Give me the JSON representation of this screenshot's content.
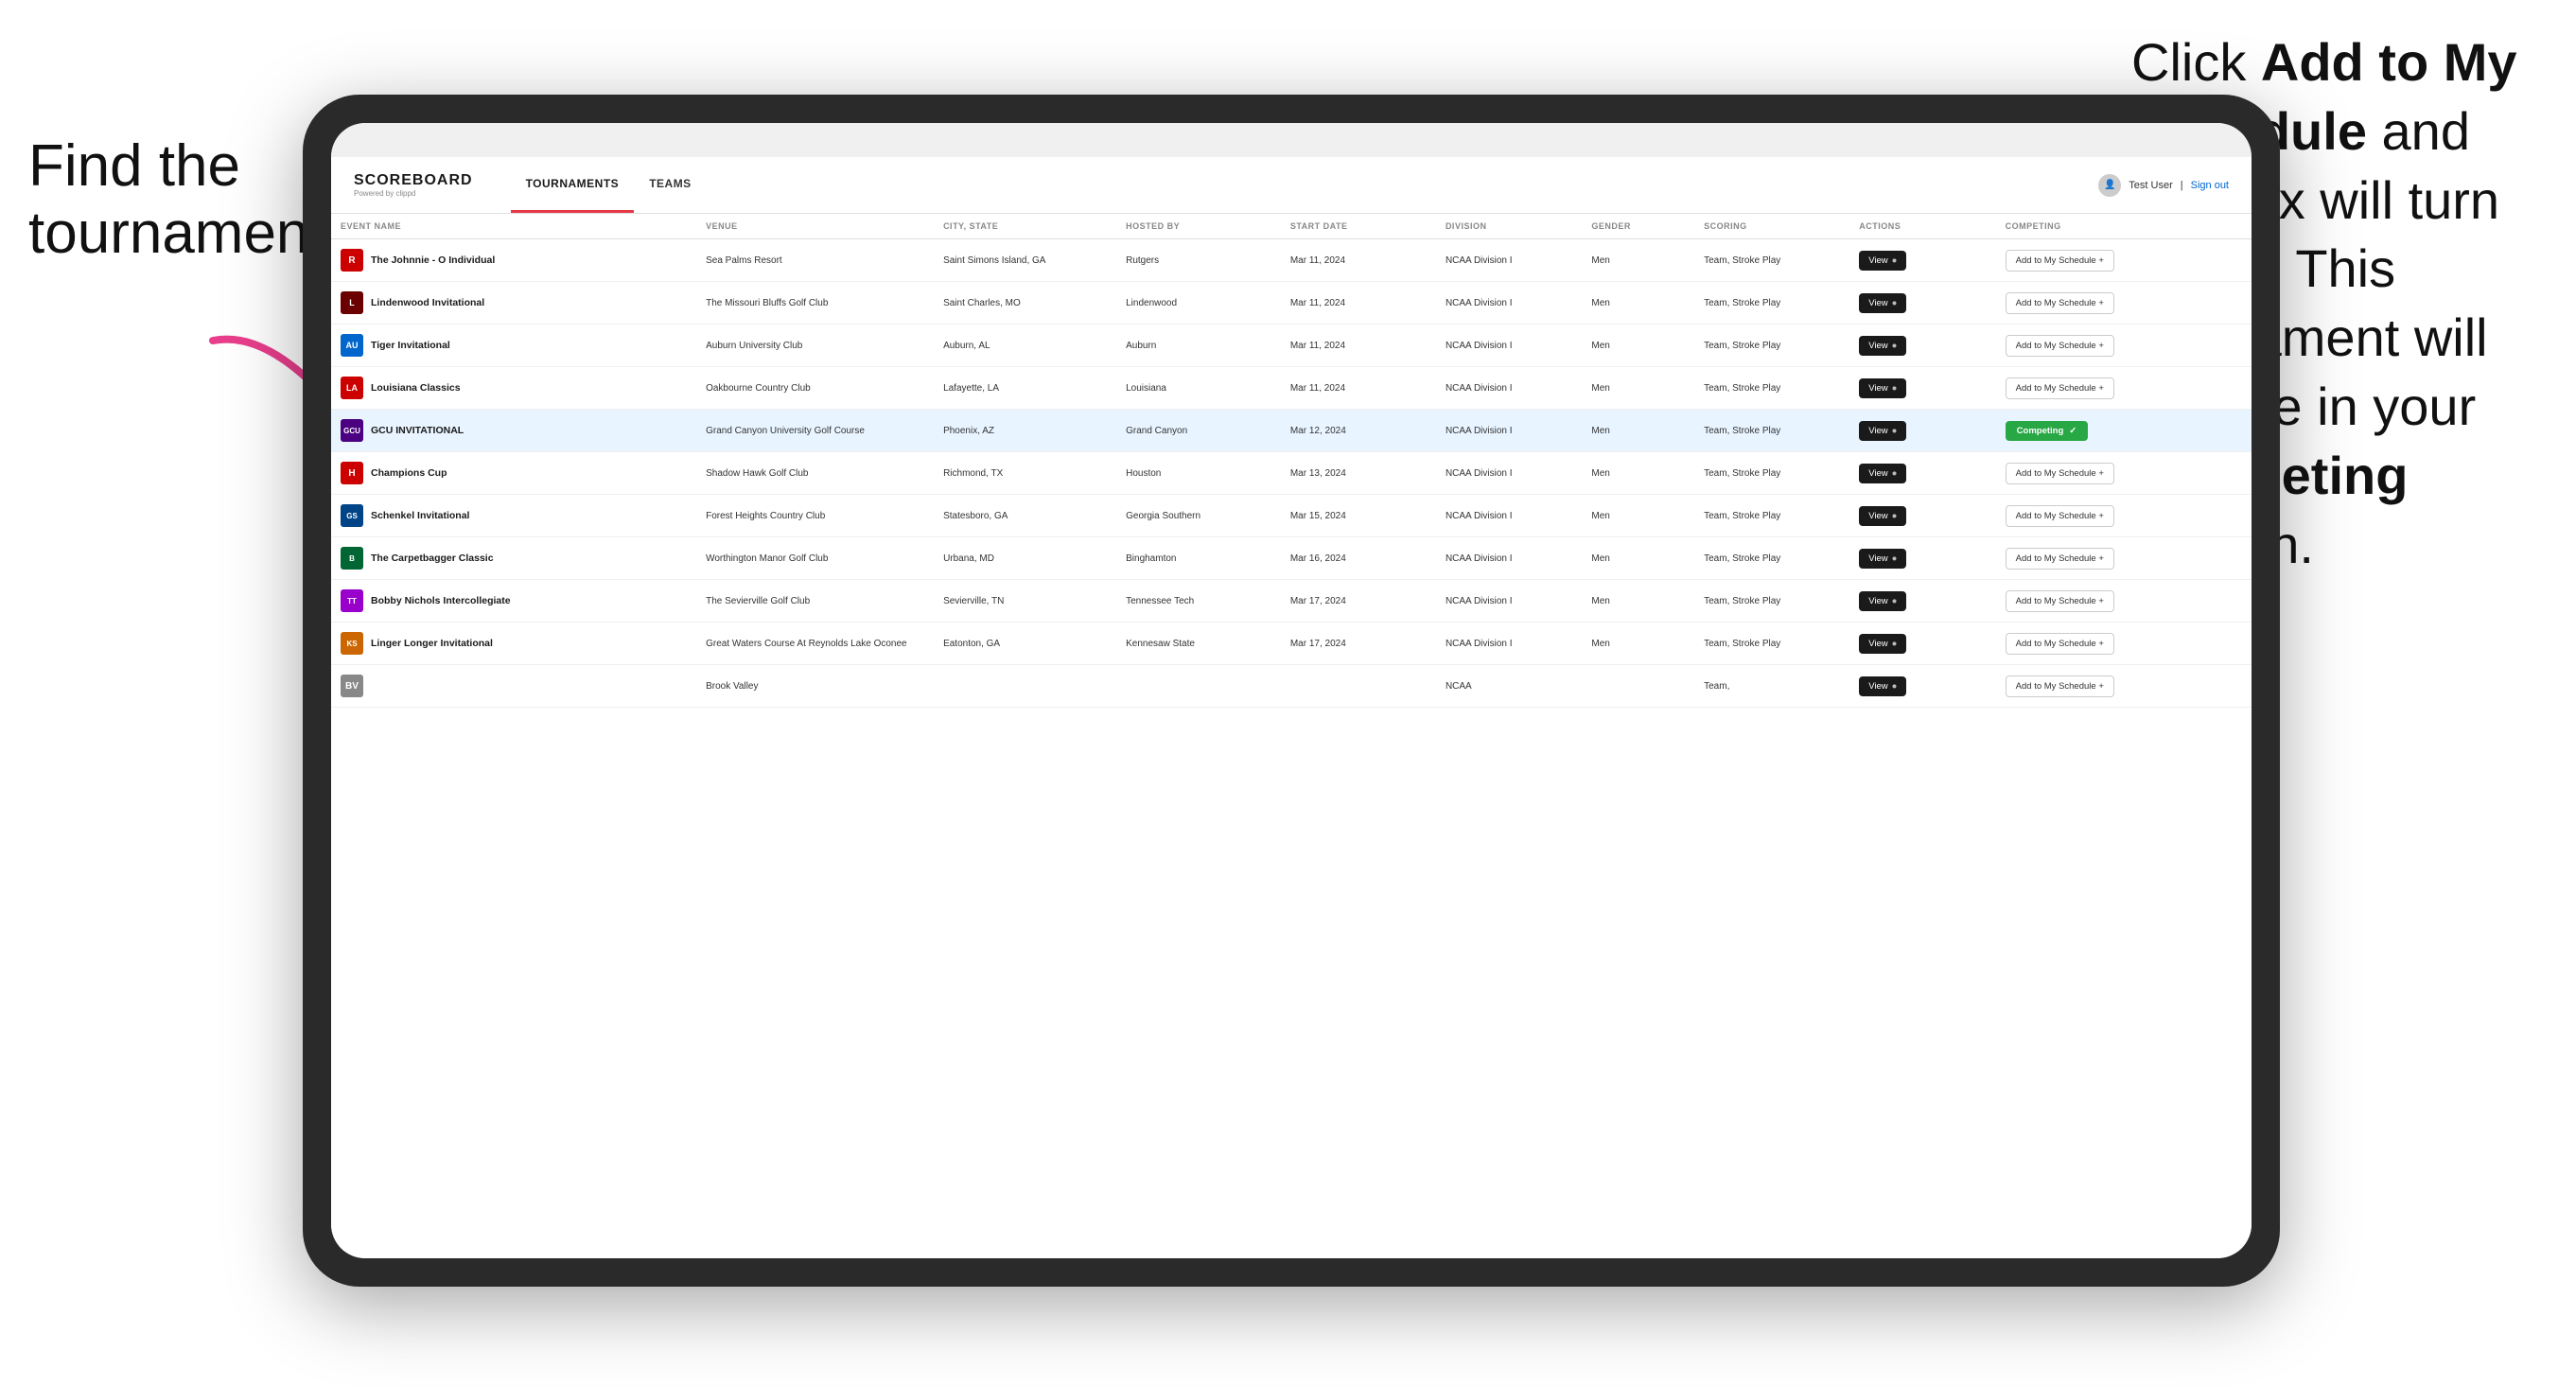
{
  "annotations": {
    "left": "Find the\ntournament.",
    "right_line1": "Click ",
    "right_bold1": "Add to My\nSchedule",
    "right_line2": " and the\nbox will turn green.\nThis tournament\nwill now be in\nyour ",
    "right_bold2": "Competing",
    "right_line3": "\nsection."
  },
  "app": {
    "logo_title": "SCOREBOARD",
    "logo_subtitle": "Powered by clippd",
    "nav_tabs": [
      {
        "label": "TOURNAMENTS",
        "active": true
      },
      {
        "label": "TEAMS",
        "active": false
      }
    ],
    "header_user": "Test User",
    "header_signout": "Sign out"
  },
  "table": {
    "columns": [
      {
        "key": "event_name",
        "label": "EVENT NAME"
      },
      {
        "key": "venue",
        "label": "VENUE"
      },
      {
        "key": "city_state",
        "label": "CITY, STATE"
      },
      {
        "key": "hosted_by",
        "label": "HOSTED BY"
      },
      {
        "key": "start_date",
        "label": "START DATE"
      },
      {
        "key": "division",
        "label": "DIVISION"
      },
      {
        "key": "gender",
        "label": "GENDER"
      },
      {
        "key": "scoring",
        "label": "SCORING"
      },
      {
        "key": "actions",
        "label": "ACTIONS"
      },
      {
        "key": "competing",
        "label": "COMPETING"
      }
    ],
    "rows": [
      {
        "logo_letter": "R",
        "logo_class": "logo-rutgers",
        "event_name": "The Johnnie - O Individual",
        "venue": "Sea Palms Resort",
        "city_state": "Saint Simons Island, GA",
        "hosted_by": "Rutgers",
        "start_date": "Mar 11, 2024",
        "division": "NCAA Division I",
        "gender": "Men",
        "scoring": "Team, Stroke Play",
        "action_label": "View",
        "competing_label": "Add to My Schedule +",
        "is_competing": false,
        "highlighted": false
      },
      {
        "logo_letter": "L",
        "logo_class": "logo-lindenwood",
        "event_name": "Lindenwood Invitational",
        "venue": "The Missouri Bluffs Golf Club",
        "city_state": "Saint Charles, MO",
        "hosted_by": "Lindenwood",
        "start_date": "Mar 11, 2024",
        "division": "NCAA Division I",
        "gender": "Men",
        "scoring": "Team, Stroke Play",
        "action_label": "View",
        "competing_label": "Add to My Schedule +",
        "is_competing": false,
        "highlighted": false
      },
      {
        "logo_letter": "AU",
        "logo_class": "logo-auburn",
        "event_name": "Tiger Invitational",
        "venue": "Auburn University Club",
        "city_state": "Auburn, AL",
        "hosted_by": "Auburn",
        "start_date": "Mar 11, 2024",
        "division": "NCAA Division I",
        "gender": "Men",
        "scoring": "Team, Stroke Play",
        "action_label": "View",
        "competing_label": "Add to My Schedule +",
        "is_competing": false,
        "highlighted": false
      },
      {
        "logo_letter": "LA",
        "logo_class": "logo-louisiana",
        "event_name": "Louisiana Classics",
        "venue": "Oakbourne Country Club",
        "city_state": "Lafayette, LA",
        "hosted_by": "Louisiana",
        "start_date": "Mar 11, 2024",
        "division": "NCAA Division I",
        "gender": "Men",
        "scoring": "Team, Stroke Play",
        "action_label": "View",
        "competing_label": "Add to My Schedule +",
        "is_competing": false,
        "highlighted": false
      },
      {
        "logo_letter": "GCU",
        "logo_class": "logo-gcu",
        "event_name": "GCU INVITATIONAL",
        "venue": "Grand Canyon University Golf Course",
        "city_state": "Phoenix, AZ",
        "hosted_by": "Grand Canyon",
        "start_date": "Mar 12, 2024",
        "division": "NCAA Division I",
        "gender": "Men",
        "scoring": "Team, Stroke Play",
        "action_label": "View",
        "competing_label": "Competing",
        "is_competing": true,
        "highlighted": true
      },
      {
        "logo_letter": "H",
        "logo_class": "logo-houston",
        "event_name": "Champions Cup",
        "venue": "Shadow Hawk Golf Club",
        "city_state": "Richmond, TX",
        "hosted_by": "Houston",
        "start_date": "Mar 13, 2024",
        "division": "NCAA Division I",
        "gender": "Men",
        "scoring": "Team, Stroke Play",
        "action_label": "View",
        "competing_label": "Add to My Schedule +",
        "is_competing": false,
        "highlighted": false
      },
      {
        "logo_letter": "GS",
        "logo_class": "logo-georgiasouth",
        "event_name": "Schenkel Invitational",
        "venue": "Forest Heights Country Club",
        "city_state": "Statesboro, GA",
        "hosted_by": "Georgia Southern",
        "start_date": "Mar 15, 2024",
        "division": "NCAA Division I",
        "gender": "Men",
        "scoring": "Team, Stroke Play",
        "action_label": "View",
        "competing_label": "Add to My Schedule +",
        "is_competing": false,
        "highlighted": false
      },
      {
        "logo_letter": "B",
        "logo_class": "logo-binghamton",
        "event_name": "The Carpetbagger Classic",
        "venue": "Worthington Manor Golf Club",
        "city_state": "Urbana, MD",
        "hosted_by": "Binghamton",
        "start_date": "Mar 16, 2024",
        "division": "NCAA Division I",
        "gender": "Men",
        "scoring": "Team, Stroke Play",
        "action_label": "View",
        "competing_label": "Add to My Schedule +",
        "is_competing": false,
        "highlighted": false
      },
      {
        "logo_letter": "TT",
        "logo_class": "logo-tenntech",
        "event_name": "Bobby Nichols Intercollegiate",
        "venue": "The Sevierville Golf Club",
        "city_state": "Sevierville, TN",
        "hosted_by": "Tennessee Tech",
        "start_date": "Mar 17, 2024",
        "division": "NCAA Division I",
        "gender": "Men",
        "scoring": "Team, Stroke Play",
        "action_label": "View",
        "competing_label": "Add to My Schedule +",
        "is_competing": false,
        "highlighted": false
      },
      {
        "logo_letter": "KS",
        "logo_class": "logo-kennesaw",
        "event_name": "Linger Longer Invitational",
        "venue": "Great Waters Course At Reynolds Lake Oconee",
        "city_state": "Eatonton, GA",
        "hosted_by": "Kennesaw State",
        "start_date": "Mar 17, 2024",
        "division": "NCAA Division I",
        "gender": "Men",
        "scoring": "Team, Stroke Play",
        "action_label": "View",
        "competing_label": "Add to My Schedule +",
        "is_competing": false,
        "highlighted": false
      },
      {
        "logo_letter": "BV",
        "logo_class": "logo-last",
        "event_name": "",
        "venue": "Brook Valley",
        "city_state": "",
        "hosted_by": "",
        "start_date": "",
        "division": "NCAA",
        "gender": "",
        "scoring": "Team,",
        "action_label": "View",
        "competing_label": "Add to My Schedule +",
        "is_competing": false,
        "highlighted": false
      }
    ]
  }
}
